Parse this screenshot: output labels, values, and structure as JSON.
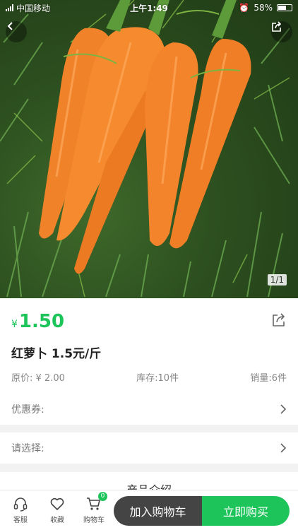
{
  "status_bar": {
    "carrier": "中国移动",
    "time": "上午1:49",
    "battery": "58%"
  },
  "hero": {
    "image_counter": "1/1",
    "icons": {
      "back": "chevron-left-icon",
      "share": "share-icon"
    }
  },
  "product": {
    "currency": "¥",
    "price": "1.50",
    "name": "红萝卜 1.5元/斤",
    "original_price": "原价: ¥ 2.00",
    "stock": "库存:10件",
    "sales": "销量:6件"
  },
  "rows": {
    "coupon_label": "优惠券:",
    "select_label": "请选择:"
  },
  "section_title": "产品介绍",
  "bottom_bar": {
    "service_label": "客服",
    "favorite_label": "收藏",
    "cart_label": "购物车",
    "cart_count": "0",
    "add_to_cart": "加入购物车",
    "buy_now": "立即购买"
  },
  "colors": {
    "accent": "#1dc45a",
    "dark_button": "#444444"
  }
}
